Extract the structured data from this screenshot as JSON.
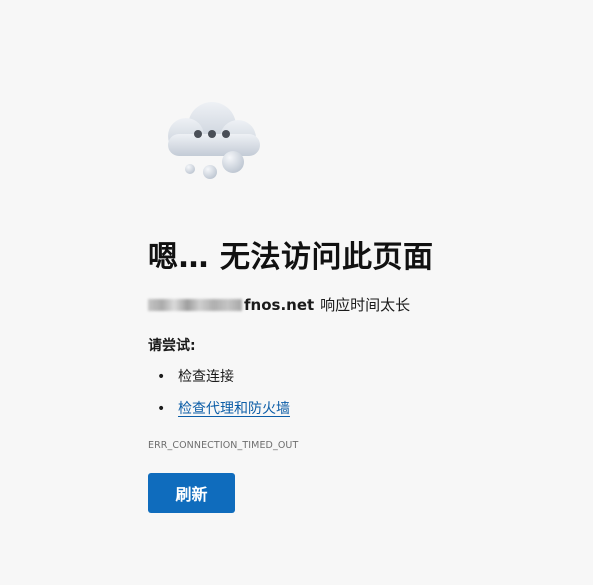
{
  "error": {
    "title": "嗯… 无法访问此页面",
    "domain": "fnos.net",
    "message": "响应时间太长",
    "try_label": "请尝试:",
    "suggestions": [
      {
        "bullet": "•",
        "text": "检查连接",
        "is_link": false
      },
      {
        "bullet": "•",
        "text": "检查代理和防火墙",
        "is_link": true
      }
    ],
    "error_code": "ERR_CONNECTION_TIMED_OUT",
    "refresh_label": "刷新"
  },
  "icons": {
    "illustration": "cloud-timeout-icon"
  },
  "colors": {
    "background": "#f7f7f7",
    "button": "#0f6cbd",
    "link": "#0b5da7",
    "error_code": "#6e6e6e"
  }
}
